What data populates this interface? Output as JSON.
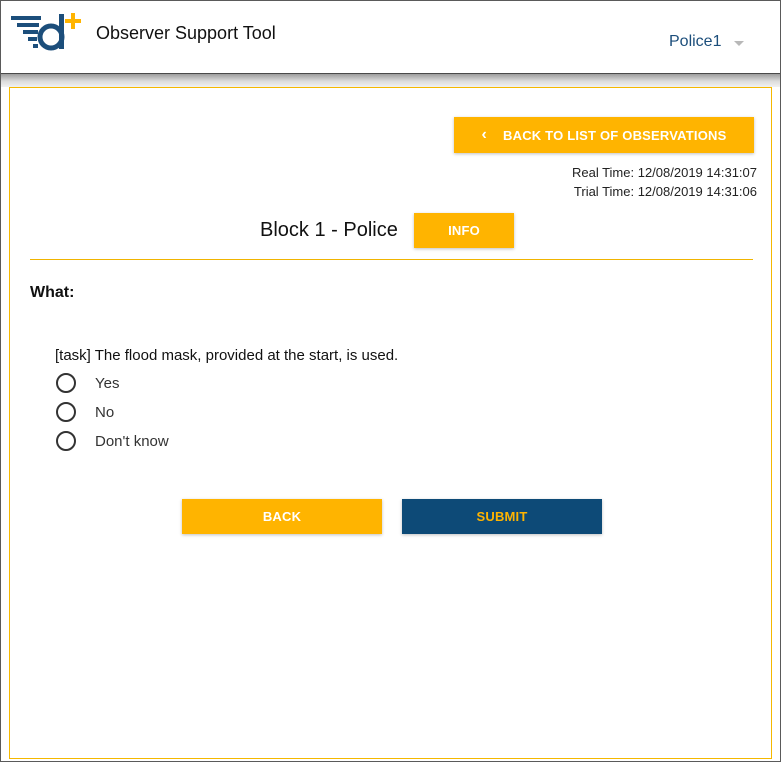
{
  "header": {
    "app_title": "Observer Support Tool",
    "user_name": "Police1",
    "logo_icon": "d-plus-logo-icon"
  },
  "toolbar": {
    "back_to_list_label": "BACK TO LIST OF OBSERVATIONS",
    "back_to_list_icon": "chevron-left-icon"
  },
  "times": {
    "real_time": "Real Time: 12/08/2019 14:31:07",
    "trial_time": "Trial Time: 12/08/2019 14:31:06"
  },
  "block": {
    "title": "Block 1 - Police",
    "info_label": "INFO"
  },
  "form": {
    "section_label": "What:",
    "question": "[task] The flood mask, provided at the start, is used.",
    "options": [
      {
        "label": "Yes",
        "selected": false
      },
      {
        "label": "No",
        "selected": false
      },
      {
        "label": "Don't know",
        "selected": false
      }
    ],
    "back_label": "BACK",
    "submit_label": "SUBMIT"
  },
  "colors": {
    "accent_yellow": "#ffb400",
    "primary_blue": "#0d4a77",
    "user_name_blue": "#1c4e7b"
  }
}
